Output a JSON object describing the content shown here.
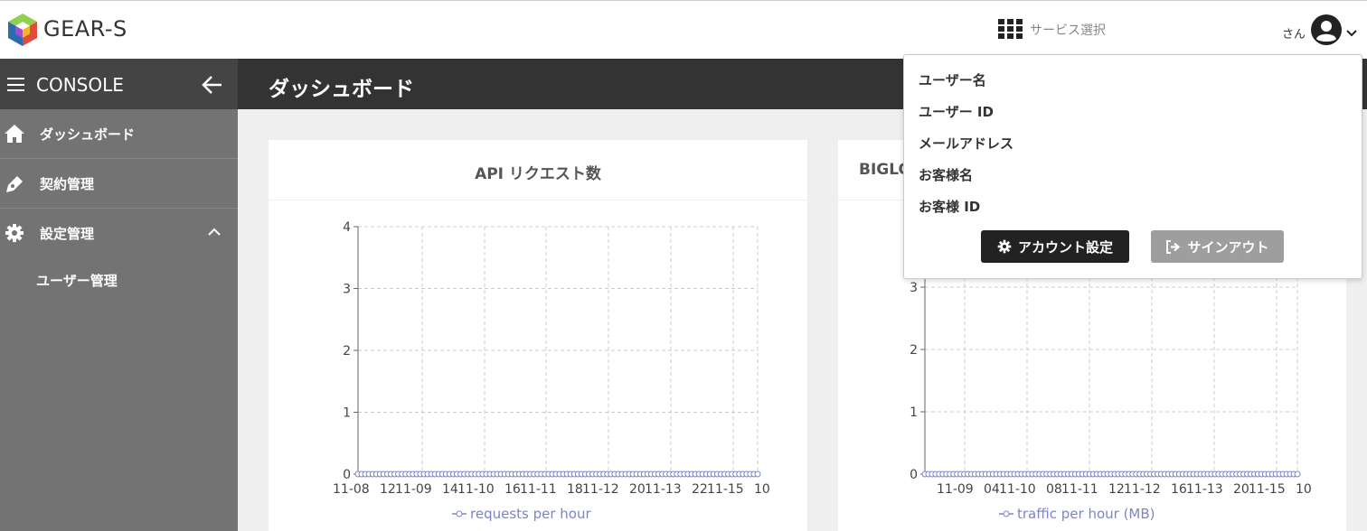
{
  "header": {
    "brand": "GEAR-S",
    "service_select": "サービス選択",
    "user_suffix": "さん"
  },
  "sidebar": {
    "title": "CONSOLE",
    "items": [
      {
        "label": "ダッシュボード",
        "icon": "home-icon"
      },
      {
        "label": "契約管理",
        "icon": "pen-icon"
      },
      {
        "label": "設定管理",
        "icon": "gear-icon",
        "expanded": true
      }
    ],
    "sub_items": [
      {
        "label": "ユーザー管理"
      }
    ]
  },
  "main": {
    "page_title": "ダッシュボード"
  },
  "dropdown": {
    "items": [
      "ユーザー名",
      "ユーザー ID",
      "メールアドレス",
      "お客様名",
      "お客様 ID"
    ],
    "account_button": "アカウント設定",
    "signout_button": "サインアウト"
  },
  "colors": {
    "sidebar_bg": "#737373",
    "sidebar_head_bg": "#444444",
    "titlebar_bg": "#333333",
    "series_color": "#7b85c9",
    "account_button_bg": "#222222",
    "signout_button_bg": "#9e9e9e"
  },
  "chart_data": [
    {
      "type": "line",
      "title": "API リクエスト数",
      "x_tick_labels": [
        "11-08",
        "12",
        "11-09",
        "14",
        "11-10",
        "16",
        "11-11",
        "18",
        "11-12",
        "20",
        "11-13",
        "22",
        "11-15",
        "10"
      ],
      "y_ticks": [
        0,
        1,
        2,
        3,
        4
      ],
      "ylim": [
        0,
        4
      ],
      "grid": true,
      "series": [
        {
          "name": "requests per hour",
          "values": [
            0
          ],
          "all_points_zero": true
        }
      ],
      "legend": "bottom"
    },
    {
      "type": "line",
      "title": "BIGLO",
      "x_tick_labels": [
        "11-09",
        "04",
        "11-10",
        "08",
        "11-11",
        "12",
        "11-12",
        "16",
        "11-13",
        "20",
        "11-15",
        "10"
      ],
      "y_ticks": [
        0,
        1,
        2,
        3
      ],
      "grid": true,
      "series": [
        {
          "name": "traffic per hour (MB)",
          "values": [
            0
          ],
          "all_points_zero": true
        }
      ],
      "legend": "bottom"
    }
  ]
}
